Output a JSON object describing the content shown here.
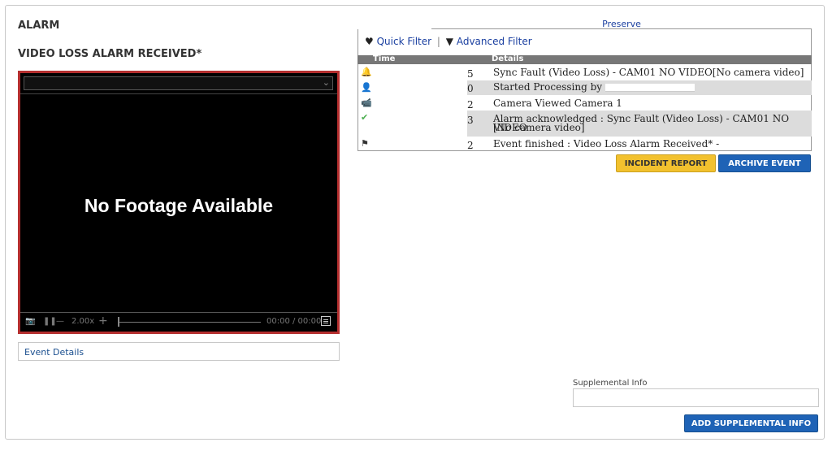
{
  "page": {
    "title": "ALARM",
    "subtitle": "VIDEO LOSS ALARM RECEIVED*"
  },
  "player": {
    "message": "No Footage Available",
    "speed": "2.00x",
    "time": "00:00 / 00:00"
  },
  "event_details": "Event Details",
  "preserve": "Preserve",
  "filters": {
    "quick": "Quick Filter",
    "separator": "|",
    "advanced": "Advanced Filter"
  },
  "table": {
    "col_time": "Time",
    "col_details": "Details",
    "rows": [
      {
        "icon": "alarm-bell-icon",
        "num": "5",
        "details": "Sync Fault (Video Loss) - CAM01 NO VIDEO[No camera video]"
      },
      {
        "icon": "user-icon",
        "num": "0",
        "details": "Started Processing by"
      },
      {
        "icon": "camera-icon",
        "num": "2",
        "details": "Camera Viewed Camera 1"
      },
      {
        "icon": "check-icon",
        "num": "3",
        "details": "Alarm acknowledged : Sync Fault (Video Loss) - CAM01 NO VIDEO",
        "details2": "[No camera video]"
      },
      {
        "icon": "finish-flag-icon",
        "num": "2",
        "details": "Event finished : Video Loss Alarm Received* -"
      }
    ]
  },
  "buttons": {
    "incident": "INCIDENT REPORT",
    "archive": "ARCHIVE EVENT",
    "add_supp": "ADD SUPPLEMENTAL INFO"
  },
  "supplemental": {
    "label": "Supplemental Info",
    "value": ""
  },
  "colors": {
    "player_border": "#b52f2f",
    "incident_btn": "#f2c12e",
    "primary_btn": "#1f63b6"
  }
}
